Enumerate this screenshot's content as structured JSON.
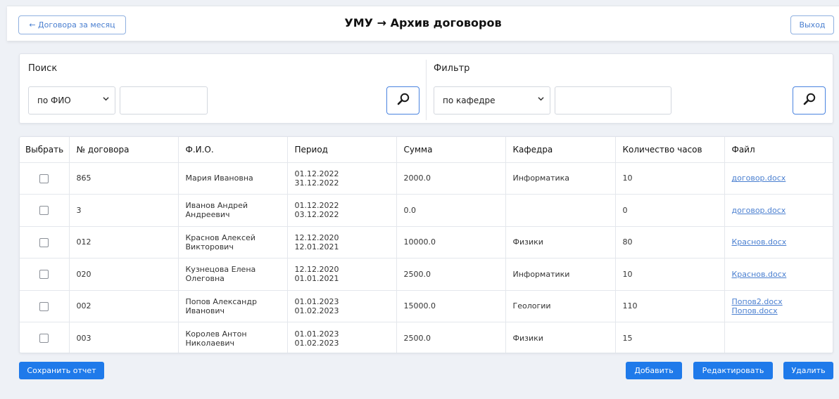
{
  "header": {
    "back_label": "← Договора за месяц",
    "title": "УМУ  →  Архив договоров",
    "exit_label": "Выход"
  },
  "search": {
    "title": "Поиск",
    "select_value": "по ФИО",
    "input_value": "",
    "button_icon": "search-icon"
  },
  "filter": {
    "title": "Фильтр",
    "select_value": "по кафедре",
    "input_value": "",
    "button_icon": "search-icon"
  },
  "table": {
    "columns": [
      "Выбрать",
      "№ договора",
      "Ф.И.О.",
      "Период",
      "Сумма",
      "Кафедра",
      "Количество часов",
      "Файл"
    ],
    "rows": [
      {
        "num": "865",
        "name1": "Мария Ивановна",
        "name2": "",
        "p1": "01.12.2022",
        "p2": "31.12.2022",
        "sum": "2000.0",
        "dept": "Информатика",
        "hours": "10",
        "file1": "договор.docx",
        "file2": ""
      },
      {
        "num": "3",
        "name1": "Иванов Андрей",
        "name2": "Андреевич",
        "p1": "01.12.2022",
        "p2": "03.12.2022",
        "sum": "0.0",
        "dept": "",
        "hours": "0",
        "file1": "договор.docx",
        "file2": ""
      },
      {
        "num": "012",
        "name1": "Краснов Алексей",
        "name2": "Викторович",
        "p1": "12.12.2020",
        "p2": "12.01.2021",
        "sum": "10000.0",
        "dept": "Физики",
        "hours": "80",
        "file1": "Краснов.docx",
        "file2": ""
      },
      {
        "num": "020",
        "name1": "Кузнецова Елена",
        "name2": "Олеговна",
        "p1": "12.12.2020",
        "p2": "01.01.2021",
        "sum": "2500.0",
        "dept": "Информатики",
        "hours": "10",
        "file1": "Краснов.docx",
        "file2": ""
      },
      {
        "num": "002",
        "name1": "Попов Александр",
        "name2": "Иванович",
        "p1": "01.01.2023",
        "p2": "01.02.2023",
        "sum": "15000.0",
        "dept": "Геологии",
        "hours": "110",
        "file1": "Попов2.docx",
        "file2": "Попов.docx"
      },
      {
        "num": "003",
        "name1": "Королев Антон",
        "name2": "Николаевич",
        "p1": "01.01.2023",
        "p2": "01.02.2023",
        "sum": "2500.0",
        "dept": "Физики",
        "hours": "15",
        "file1": "",
        "file2": ""
      }
    ]
  },
  "actions": {
    "save_report": "Сохранить отчет",
    "add": "Добавить",
    "edit": "Редактировать",
    "delete": "Удалить"
  },
  "colors": {
    "primary": "#1f7aea",
    "link": "#4a7fd0",
    "background": "#eef1f6"
  }
}
